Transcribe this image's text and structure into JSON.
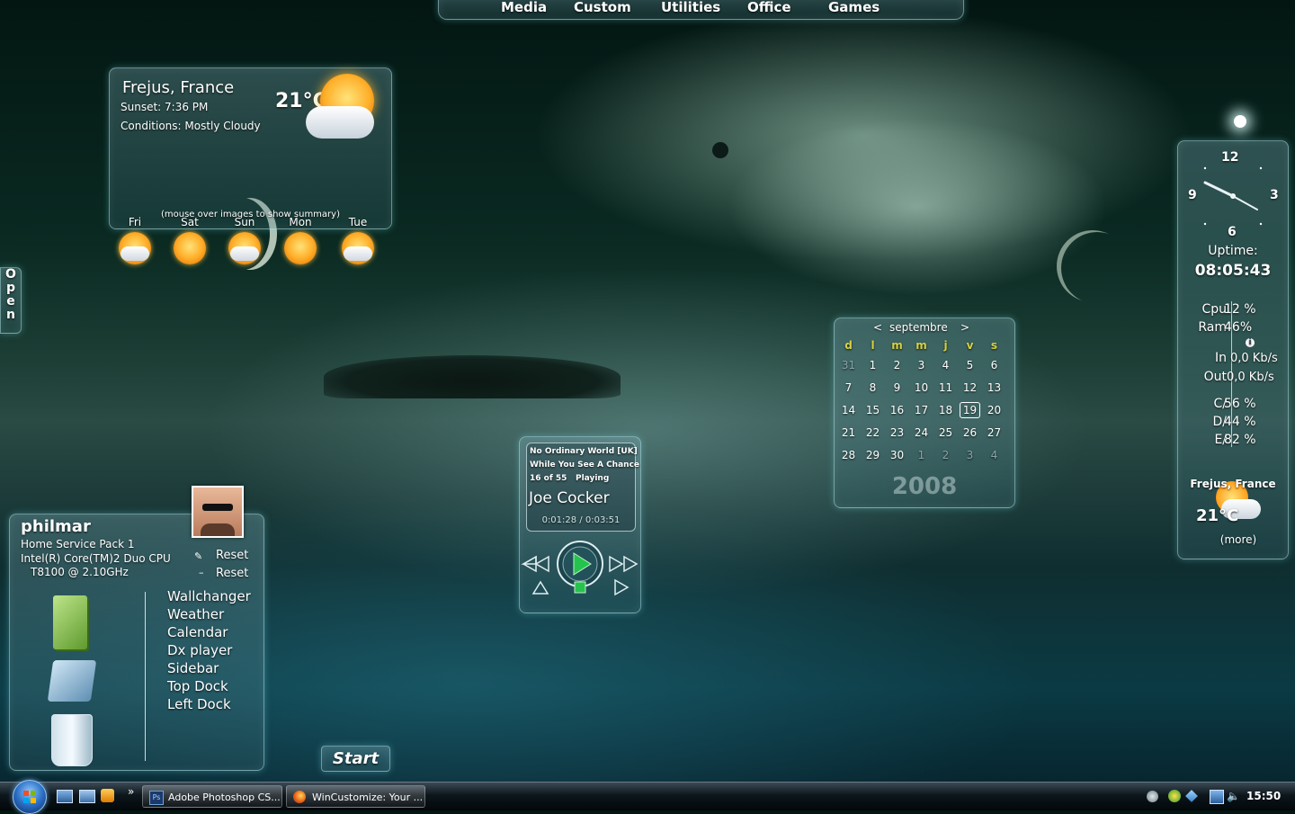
{
  "top_dock": {
    "tabs": [
      "Media",
      "Custom",
      "Utilities",
      "Office",
      "Games"
    ]
  },
  "weather": {
    "city": "Frejus, France",
    "sunset": "Sunset: 7:36 PM",
    "conditions": "Conditions: Mostly Cloudy",
    "temp": "21°C",
    "forecast": [
      "Fri",
      "Sat",
      "Sun",
      "Mon",
      "Tue"
    ],
    "hint": "(mouse over images to show summary)"
  },
  "open_tab": {
    "letters": [
      "O",
      "p",
      "e",
      "n"
    ]
  },
  "sidebar": {
    "clock": {
      "n12": "12",
      "n3": "3",
      "n6": "6",
      "n9": "9"
    },
    "uptime_label": "Uptime:",
    "uptime": "08:05:43",
    "cpu_label": "Cpu",
    "cpu": "12 %",
    "ram_label": "Ram",
    "ram": "46%",
    "info": "i",
    "in_label": "In",
    "in": "0,0 Kb/s",
    "out_label": "Out",
    "out": "0,0 Kb/s",
    "c_label": "C/",
    "c": "56 %",
    "d_label": "D/",
    "d": "44 %",
    "e_label": "E/",
    "e": "82 %",
    "mini_city": "Frejus, France",
    "mini_temp": "21°C",
    "more": "(more)"
  },
  "calendar": {
    "prev": "<",
    "month": "septembre",
    "next": ">",
    "weekdays": [
      "d",
      "l",
      "m",
      "m",
      "j",
      "v",
      "s"
    ],
    "weeks": [
      [
        "31",
        "1",
        "2",
        "3",
        "4",
        "5",
        "6"
      ],
      [
        "7",
        "8",
        "9",
        "10",
        "11",
        "12",
        "13"
      ],
      [
        "14",
        "15",
        "16",
        "17",
        "18",
        "19",
        "20"
      ],
      [
        "21",
        "22",
        "23",
        "24",
        "25",
        "26",
        "27"
      ],
      [
        "28",
        "29",
        "30",
        "1",
        "2",
        "3",
        "4"
      ]
    ],
    "today": "19",
    "year": "2008"
  },
  "player": {
    "album": "No Ordinary World [UK]",
    "track": "While You See A Chance",
    "position": "16 of 55",
    "state": "Playing",
    "artist": "Joe Cocker",
    "time": "0:01:28 / 0:03:51"
  },
  "user": {
    "name": "philmar",
    "os": "Home Service Pack 1",
    "cpu1": "Intel(R) Core(TM)2 Duo CPU",
    "cpu2": "T8100  @ 2.10GHz",
    "reset1": "Reset",
    "reset2": "Reset",
    "menu": [
      "Wallchanger",
      "Weather",
      "Calendar",
      "Dx player",
      "Sidebar",
      "Top Dock",
      "Left Dock"
    ]
  },
  "start_label": "Start",
  "taskbar": {
    "tasks": [
      "Adobe Photoshop CS...",
      "WinCustomize: Your ..."
    ],
    "time": "15:50",
    "chevron": "»"
  },
  "colors": {
    "accent": "#b7e6ea",
    "calendar_weekday": "#d7d040",
    "calendar_faded": "#8aa5a8"
  }
}
